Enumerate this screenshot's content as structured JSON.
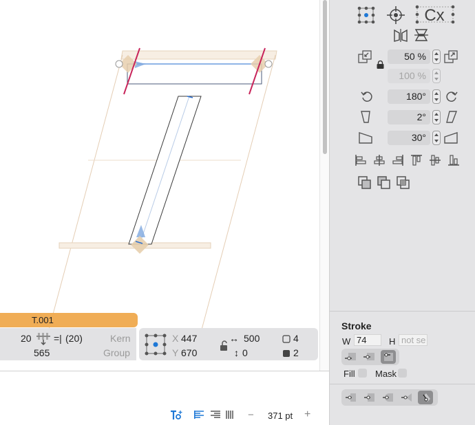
{
  "glyph": {
    "name": "T.001"
  },
  "metrics": {
    "lsb": "20",
    "rsb_label": "=|",
    "rsb": "(20)",
    "width": "565",
    "kern_label": "Kern",
    "group_label": "Group"
  },
  "selection": {
    "x_label": "X",
    "x": "447",
    "y_label": "Y",
    "y": "670",
    "w_symbol": "↔",
    "w": "500",
    "h_symbol": "↕",
    "h": "0",
    "nodes_count": "4",
    "selected_count": "2"
  },
  "transform": {
    "scale": "50 %",
    "scale_y": "100 %",
    "rotate": "180°",
    "slant": "2°",
    "skew": "30°",
    "cx_label": "Cx"
  },
  "stroke": {
    "title": "Stroke",
    "w_label": "W",
    "w_value": "74",
    "h_label": "H",
    "h_placeholder": "not se",
    "fill_label": "Fill",
    "mask_label": "Mask"
  },
  "text_toolbar": {
    "size": "371 pt",
    "minus": "−",
    "plus": "+"
  },
  "colors": {
    "glyph_tab": "#f0ad56",
    "guide_pink": "#c8245a",
    "node_blue": "#2266dd",
    "accent_blue": "#1e78d6"
  }
}
